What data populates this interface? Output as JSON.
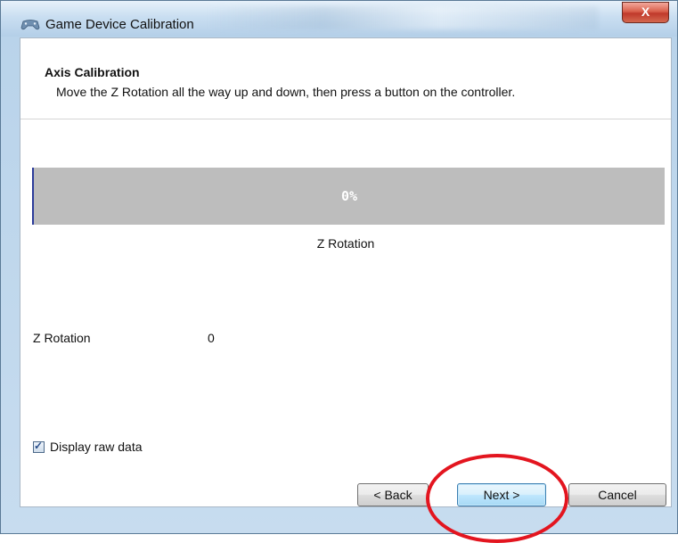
{
  "window": {
    "title": "Game Device Calibration",
    "close_label": "X",
    "icon": "game-controller-icon"
  },
  "header": {
    "title": "Axis Calibration",
    "description": "Move the Z Rotation all the way up and down, then press a button on the controller."
  },
  "progress": {
    "value_percent": 0,
    "text": "0%",
    "caption": "Z Rotation"
  },
  "raw_data": {
    "label": "Z Rotation",
    "value": "0"
  },
  "checkbox": {
    "label": "Display raw data",
    "checked": true
  },
  "buttons": {
    "back": "< Back",
    "next": "Next >",
    "cancel": "Cancel"
  },
  "colors": {
    "progress_track": "#bdbdbd",
    "annotation": "#e3151f",
    "close_button": "#c0392b"
  }
}
